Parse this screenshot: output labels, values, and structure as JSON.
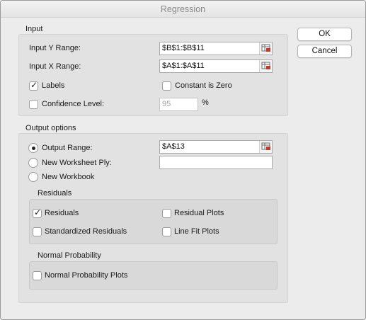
{
  "window": {
    "title": "Regression"
  },
  "buttons": {
    "ok": "OK",
    "cancel": "Cancel"
  },
  "input": {
    "group_label": "Input",
    "y_range_label": "Input Y Range:",
    "y_range_value": "$B$1:$B$11",
    "x_range_label": "Input X Range:",
    "x_range_value": "$A$1:$A$11",
    "labels": {
      "label": "Labels",
      "checked": true
    },
    "constant_zero": {
      "label": "Constant is Zero",
      "checked": false
    },
    "confidence": {
      "label": "Confidence Level:",
      "checked": false,
      "value": "95",
      "unit": "%"
    }
  },
  "output": {
    "group_label": "Output options",
    "output_range": {
      "label": "Output Range:",
      "selected": true,
      "value": "$A$13"
    },
    "new_worksheet": {
      "label": "New Worksheet Ply:",
      "selected": false,
      "value": ""
    },
    "new_workbook": {
      "label": "New Workbook",
      "selected": false
    },
    "residuals": {
      "group_label": "Residuals",
      "residuals": {
        "label": "Residuals",
        "checked": true
      },
      "residual_plots": {
        "label": "Residual Plots",
        "checked": false
      },
      "standardized": {
        "label": "Standardized Residuals",
        "checked": false
      },
      "line_fit": {
        "label": "Line Fit Plots",
        "checked": false
      }
    },
    "normal_probability": {
      "group_label": "Normal Probability",
      "plots": {
        "label": "Normal Probability Plots",
        "checked": false
      }
    }
  },
  "icons": {
    "range_picker": "range-picker-icon",
    "checkmark": "checkmark-icon"
  }
}
